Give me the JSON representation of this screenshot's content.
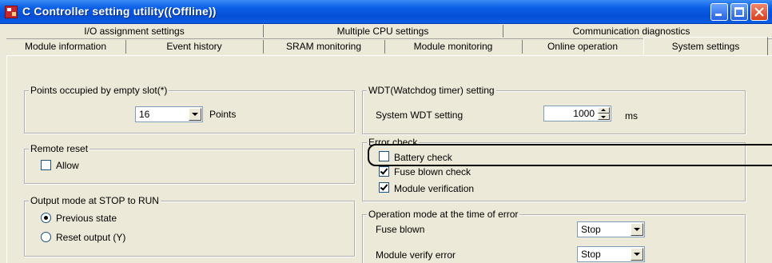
{
  "window": {
    "title": "C Controller setting utility((Offline))"
  },
  "tabs": {
    "row1": [
      {
        "label": "I/O assignment settings"
      },
      {
        "label": "Multiple CPU settings"
      },
      {
        "label": "Communication diagnostics"
      }
    ],
    "row2": [
      {
        "label": "Module information"
      },
      {
        "label": "Event history"
      },
      {
        "label": "SRAM monitoring"
      },
      {
        "label": "Module monitoring"
      },
      {
        "label": "Online operation"
      },
      {
        "label": "System settings"
      }
    ],
    "active": "System settings"
  },
  "points_group": {
    "title": "Points occupied by empty slot(*)",
    "value": "16",
    "unit": "Points"
  },
  "remote_reset": {
    "title": "Remote reset",
    "allow_label": "Allow",
    "allow_checked": false
  },
  "output_mode": {
    "title": "Output mode at STOP to RUN",
    "options": [
      {
        "label": "Previous state",
        "selected": true
      },
      {
        "label": "Reset output (Y)",
        "selected": false
      }
    ]
  },
  "wdt": {
    "title": "WDT(Watchdog timer) setting",
    "label": "System WDT setting",
    "value": "1000",
    "unit": "ms"
  },
  "error_check": {
    "title": "Error check",
    "items": [
      {
        "label": "Battery check",
        "checked": false
      },
      {
        "label": "Fuse blown check",
        "checked": true
      },
      {
        "label": "Module verification",
        "checked": true
      }
    ]
  },
  "operation_mode": {
    "title": "Operation mode at the time of error",
    "rows": [
      {
        "label": "Fuse blown",
        "value": "Stop"
      },
      {
        "label": "Module verify error",
        "value": "Stop"
      }
    ]
  },
  "colors": {
    "titlebar": "#0a5ee6",
    "dialog_bg": "#ece9d8",
    "input_border": "#7f9db9"
  }
}
